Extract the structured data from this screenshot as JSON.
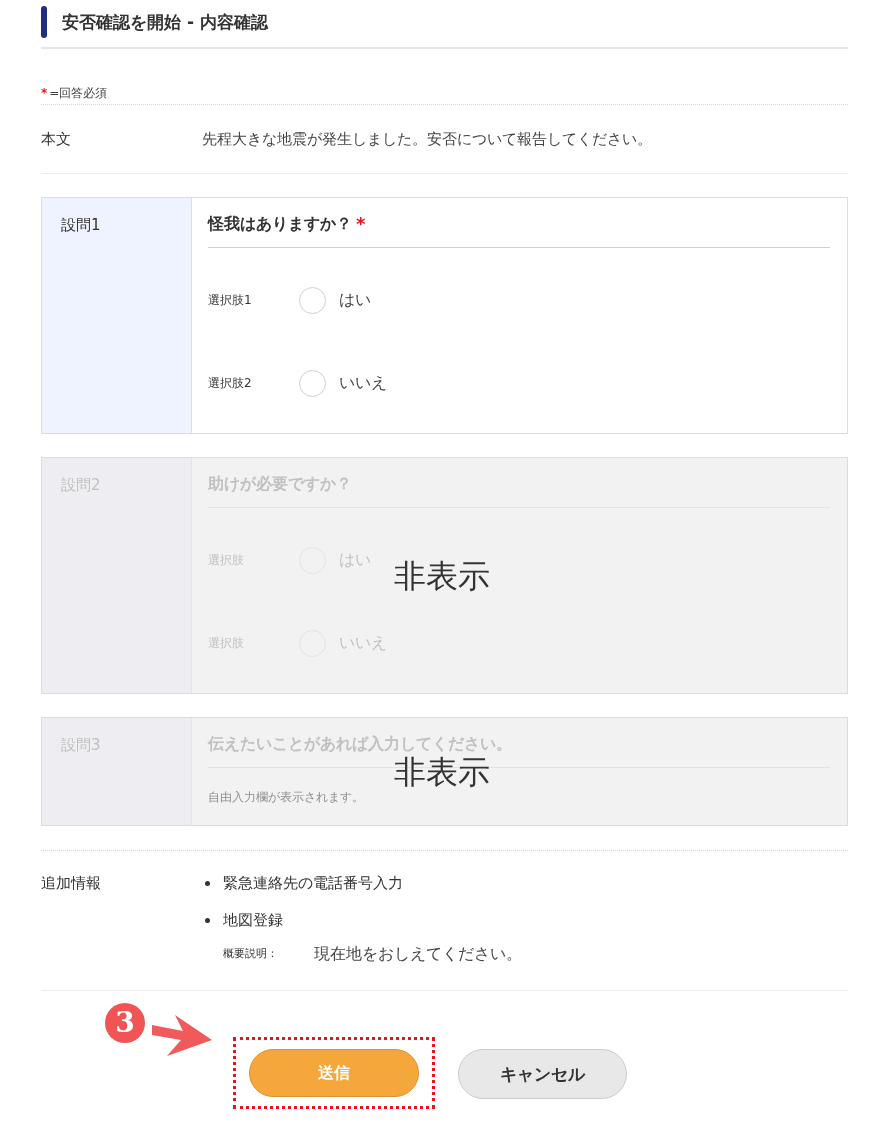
{
  "header": {
    "title": "安否確認を開始 - 内容確認"
  },
  "required_note": {
    "mark": "*",
    "text": "=回答必須"
  },
  "body": {
    "label": "本文",
    "text": "先程大きな地震が発生しました。安否について報告してください。"
  },
  "questions": [
    {
      "kind": "choice",
      "label": "設問1",
      "title": "怪我はありますか？",
      "required_mark": "*",
      "disabled": false,
      "options": [
        {
          "label": "選択肢1",
          "text": "はい",
          "selected": false
        },
        {
          "label": "選択肢2",
          "text": "いいえ",
          "selected": false
        }
      ]
    },
    {
      "kind": "choice",
      "label": "設問2",
      "title": "助けが必要ですか？",
      "disabled": true,
      "overlay": "非表示",
      "options": [
        {
          "label": "選択肢",
          "text": "はい",
          "selected": false
        },
        {
          "label": "選択肢",
          "text": "いいえ",
          "selected": false
        }
      ]
    },
    {
      "kind": "free_text",
      "label": "設問3",
      "title": "伝えたいことがあれば入力してください。",
      "disabled": true,
      "hint": "自由入力欄が表示されます。",
      "overlay": "非表示"
    }
  ],
  "additional_info": {
    "label": "追加情報",
    "items": [
      {
        "text": "緊急連絡先の電話番号入力"
      },
      {
        "text": "地図登録",
        "description_label": "概要説明：",
        "description": "現在地をおしえてください。"
      }
    ]
  },
  "annotation": {
    "step": "3"
  },
  "buttons": [
    {
      "kind": "primary",
      "label": "送信",
      "highlighted": true
    },
    {
      "kind": "secondary",
      "label": "キャンセル",
      "highlighted": false
    }
  ]
}
